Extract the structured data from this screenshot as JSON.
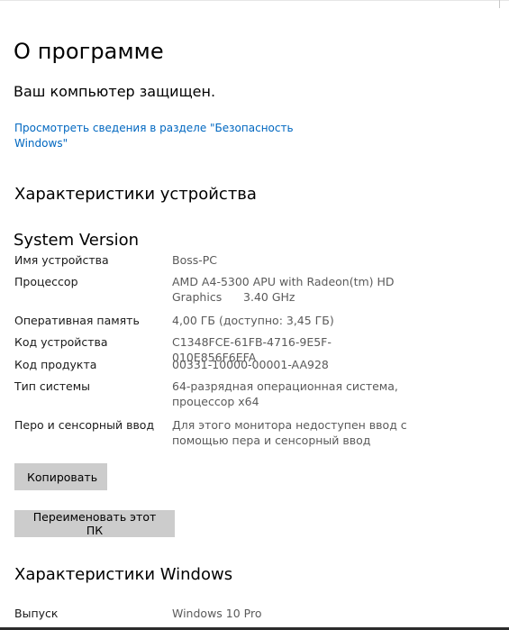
{
  "page": {
    "title": "О программе",
    "protection_status": "Ваш компьютер защищен.",
    "security_link": "Просмотреть сведения в разделе \"Безопасность Windows\""
  },
  "device_specs": {
    "heading": "Характеристики устройства",
    "subheading": "System Version",
    "rows": [
      {
        "label": "Имя устройства",
        "value": "Boss-PC"
      },
      {
        "label": "Процессор",
        "value": "AMD A4-5300 APU with Radeon(tm) HD Graphics      3.40 GHz"
      },
      {
        "label": "Оперативная память",
        "value": "4,00 ГБ (доступно: 3,45 ГБ)"
      },
      {
        "label": "Код устройства",
        "value": "C1348FCE-61FB-4716-9E5F-010E856F6EFA"
      },
      {
        "label": "Код продукта",
        "value": "00331-10000-00001-AA928"
      },
      {
        "label": "Тип системы",
        "value": "64-разрядная операционная система, процессор x64"
      },
      {
        "label": "Перо и сенсорный ввод",
        "value": "Для этого монитора недоступен ввод с помощью пера и сенсорный ввод"
      }
    ]
  },
  "buttons": {
    "copy": "Копировать",
    "rename": "Переименовать этот ПК"
  },
  "windows_specs": {
    "heading": "Характеристики Windows",
    "rows": [
      {
        "label": "Выпуск",
        "value": "Windows 10 Pro"
      }
    ]
  },
  "colors": {
    "link": "#0067c0",
    "button_bg": "#cccccc",
    "value_text": "#5a5a5a"
  }
}
